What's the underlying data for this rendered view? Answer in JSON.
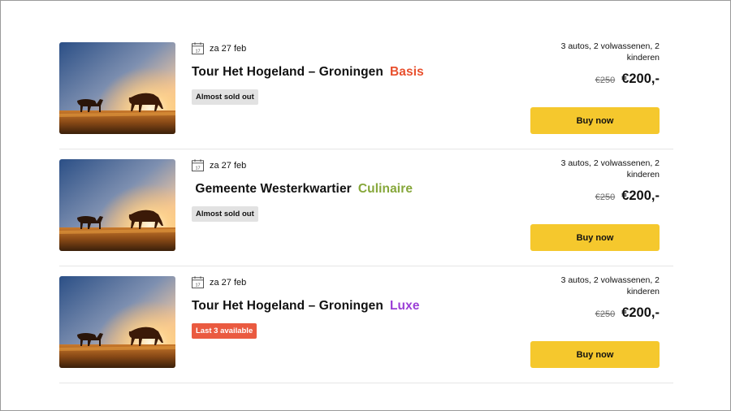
{
  "offers": [
    {
      "date": "za 27 feb",
      "title": "Tour Het Hogeland – Groningen",
      "tier": "Basis",
      "tier_color": "#e8502e",
      "badge": "Almost sold out",
      "badge_style": "grey",
      "travellers": "3 autos,  2 volwassenen,  2 kinderen",
      "old_price": "€250",
      "price": "€200,-",
      "buy_label": "Buy now"
    },
    {
      "date": "za 27 feb",
      "title": " Gemeente Westerkwartier",
      "tier": "Culinaire",
      "tier_color": "#86a73a",
      "badge": "Almost sold out",
      "badge_style": "grey",
      "travellers": "3 autos,  2 volwassenen,  2 kinderen",
      "old_price": "€250",
      "price": "€200,-",
      "buy_label": "Buy now"
    },
    {
      "date": "za 27 feb",
      "title": "Tour Het Hogeland – Groningen",
      "tier": "Luxe",
      "tier_color": "#9b3fd6",
      "badge": "Last 3 available",
      "badge_style": "red",
      "travellers": "3 autos,  2 volwassenen,  2 kinderen",
      "old_price": "€250",
      "price": "€200,-",
      "buy_label": "Buy now"
    }
  ],
  "icons": {
    "date": "calendar-icon",
    "calendar_day": "17"
  },
  "colors": {
    "button": "#f5c82d",
    "separator": "#e6e6e6"
  }
}
